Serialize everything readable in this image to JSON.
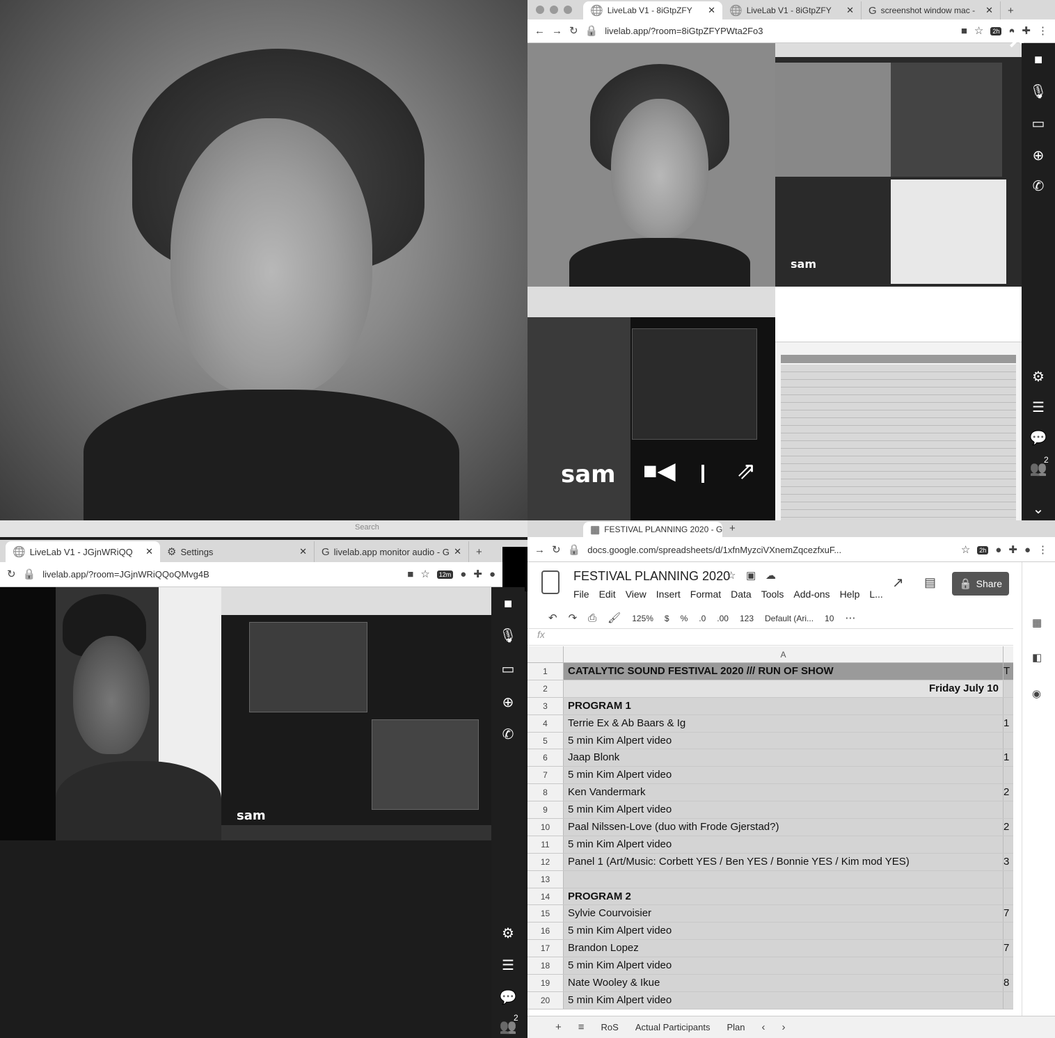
{
  "top_right": {
    "tabs": [
      {
        "label": "LiveLab V1 - 8iGtpZFY"
      },
      {
        "label": "LiveLab V1 - 8iGtpZFY"
      },
      {
        "label": "screenshot window mac -"
      }
    ],
    "url": "livelab.app/?room=8iGtpZFYPWta2Fo3",
    "badge": "2h",
    "participant_name": "sam",
    "participants_count": "2"
  },
  "bottom_left": {
    "tabs": [
      {
        "label": "LiveLab V1 - JGjnWRiQQ"
      },
      {
        "label": "Settings"
      },
      {
        "label": "livelab.app monitor audio - G"
      }
    ],
    "url": "livelab.app/?room=JGjnWRiQQoQMvg4B",
    "badge": "12m",
    "participant_name": "sam",
    "participants_count": "2",
    "search_placeholder": "Search"
  },
  "sheets": {
    "tab_label": "FESTIVAL PLANNING 2020 - G",
    "url": "docs.google.com/spreadsheets/d/1xfnMyzciVXnemZqcezfxuF...",
    "badge": "2h",
    "title": "FESTIVAL PLANNING 2020",
    "menu": [
      "File",
      "Edit",
      "View",
      "Insert",
      "Format",
      "Data",
      "Tools",
      "Add-ons",
      "Help",
      "L..."
    ],
    "share_label": "Share",
    "toolbar": {
      "zoom": "125%",
      "currency": "$",
      "percent": "%",
      "dec_less": ".0",
      "dec_more": ".00",
      "format": "123",
      "font": "Default (Ari...",
      "size": "10"
    },
    "fx_label": "fx",
    "column_a": "A",
    "rows": [
      {
        "n": "1",
        "a": "CATALYTIC SOUND FESTIVAL 2020 /// RUN OF SHOW",
        "t": "T"
      },
      {
        "n": "2",
        "a": "Friday July 10",
        "t": ""
      },
      {
        "n": "3",
        "a": "PROGRAM 1",
        "t": ""
      },
      {
        "n": "4",
        "a": "Terrie Ex & Ab Baars & Ig",
        "t": "1"
      },
      {
        "n": "5",
        "a": "5 min Kim Alpert video",
        "t": ""
      },
      {
        "n": "6",
        "a": "Jaap Blonk",
        "t": "1"
      },
      {
        "n": "7",
        "a": "5 min Kim Alpert video",
        "t": ""
      },
      {
        "n": "8",
        "a": "Ken Vandermark",
        "t": "2"
      },
      {
        "n": "9",
        "a": "5 min Kim Alpert video",
        "t": ""
      },
      {
        "n": "10",
        "a": "Paal Nilssen-Love (duo with Frode Gjerstad?)",
        "t": "2"
      },
      {
        "n": "11",
        "a": "5 min Kim Alpert video",
        "t": ""
      },
      {
        "n": "12",
        "a": "Panel 1 (Art/Music: Corbett YES / Ben YES / Bonnie YES / Kim mod YES)",
        "t": "3"
      },
      {
        "n": "13",
        "a": "",
        "t": ""
      },
      {
        "n": "14",
        "a": "PROGRAM 2",
        "t": ""
      },
      {
        "n": "15",
        "a": "Sylvie Courvoisier",
        "t": "7"
      },
      {
        "n": "16",
        "a": "5 min Kim Alpert video",
        "t": ""
      },
      {
        "n": "17",
        "a": "Brandon Lopez",
        "t": "7"
      },
      {
        "n": "18",
        "a": "5 min Kim Alpert video",
        "t": ""
      },
      {
        "n": "19",
        "a": "Nate Wooley & Ikue",
        "t": "8"
      },
      {
        "n": "20",
        "a": "5 min Kim Alpert video",
        "t": ""
      }
    ],
    "sheet_tabs": [
      "RoS",
      "Actual Participants",
      "Plan"
    ]
  }
}
